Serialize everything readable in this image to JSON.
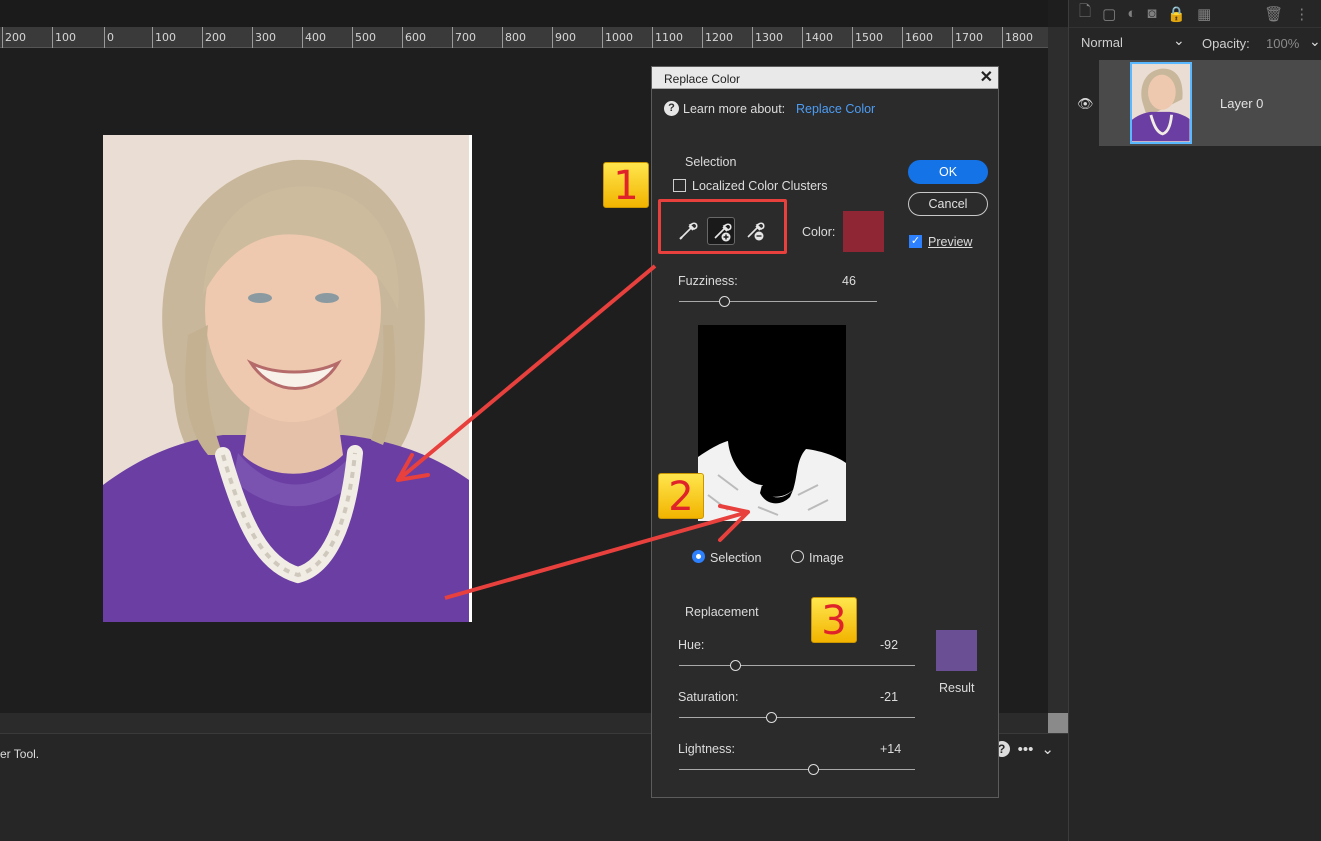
{
  "ruler": {
    "ticks": [
      "200",
      "100",
      "0",
      "100",
      "200",
      "300",
      "400",
      "500",
      "600",
      "700",
      "800",
      "900",
      "1000",
      "1100",
      "1200",
      "1300",
      "1400",
      "1500",
      "1600",
      "1700",
      "1800"
    ]
  },
  "status_bar": {
    "text": "er Tool."
  },
  "layers_panel": {
    "blend_mode": "Normal",
    "opacity_label": "Opacity:",
    "opacity_value": "100%",
    "layer_name": "Layer 0"
  },
  "dialog": {
    "title": "Replace Color",
    "learn_more_label": "Learn more about:",
    "learn_more_link": "Replace Color",
    "selection_heading": "Selection",
    "localized_clusters_label": "Localized Color Clusters",
    "localized_clusters_checked": false,
    "color_label": "Color:",
    "selected_color": "#8f2634",
    "fuzziness_label": "Fuzziness:",
    "fuzziness_value": "46",
    "fuzziness_fraction": 0.23,
    "view_selection_label": "Selection",
    "view_image_label": "Image",
    "view_mode": "Selection",
    "ok_label": "OK",
    "cancel_label": "Cancel",
    "preview_label": "Preview",
    "preview_checked": true,
    "replacement_heading": "Replacement",
    "hue_label": "Hue:",
    "hue_value": "-92",
    "hue_fraction": 0.24,
    "saturation_label": "Saturation:",
    "saturation_value": "-21",
    "saturation_fraction": 0.39,
    "lightness_label": "Lightness:",
    "lightness_value": "+14",
    "lightness_fraction": 0.57,
    "result_label": "Result",
    "result_color": "#6a4f94"
  },
  "callouts": [
    "1",
    "2",
    "3"
  ],
  "colors": {
    "accent": "#1473e6",
    "callout_red": "#e8403d",
    "badge_yellow": "#f5c518"
  }
}
